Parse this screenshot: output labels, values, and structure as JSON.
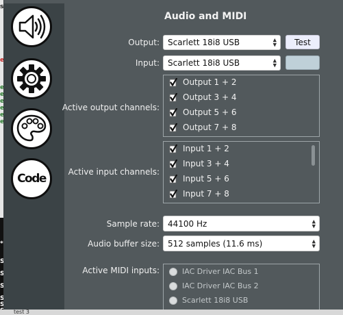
{
  "background_app": {
    "bottom_label": "test 3",
    "edge_chars": [
      "s",
      "e",
      "e",
      "e",
      "e",
      "e",
      "e",
      "e",
      "*",
      "S",
      "S",
      "S",
      "S",
      "S",
      "S"
    ]
  },
  "sidebar": {
    "items": [
      {
        "name": "audio",
        "icon": "speaker-icon"
      },
      {
        "name": "general",
        "icon": "gear-icon"
      },
      {
        "name": "appearance",
        "icon": "palette-icon"
      },
      {
        "name": "code",
        "icon": "code-icon",
        "label": "Code"
      }
    ]
  },
  "panel": {
    "title": "Audio and MIDI",
    "output_label": "Output:",
    "output_value": "Scarlett 18i8 USB",
    "test_button": "Test",
    "input_label": "Input:",
    "input_value": "Scarlett 18i8 USB",
    "active_output_label": "Active output channels:",
    "output_channels": [
      {
        "label": "Output 1 + 2",
        "checked": true
      },
      {
        "label": "Output 3 + 4",
        "checked": true
      },
      {
        "label": "Output 5 + 6",
        "checked": true
      },
      {
        "label": "Output 7 + 8",
        "checked": true
      }
    ],
    "active_input_label": "Active input channels:",
    "input_channels": [
      {
        "label": "Input 1 + 2",
        "checked": true
      },
      {
        "label": "Input 3 + 4",
        "checked": true
      },
      {
        "label": "Input 5 + 6",
        "checked": true
      },
      {
        "label": "Input 7 + 8",
        "checked": true
      }
    ],
    "sample_rate_label": "Sample rate:",
    "sample_rate_value": "44100 Hz",
    "buffer_label": "Audio buffer size:",
    "buffer_value": "512 samples (11.6 ms)",
    "midi_label": "Active MIDI inputs:",
    "midi_inputs": [
      {
        "label": "IAC Driver IAC Bus 1",
        "selected": false
      },
      {
        "label": "IAC Driver IAC Bus 2",
        "selected": false
      },
      {
        "label": "Scarlett 18i8 USB",
        "selected": false
      }
    ]
  },
  "colors": {
    "panel_bg": "#52595c",
    "sidebar_bg": "#3b4346",
    "swatch": "#bfd0d8",
    "test_button_bg": "#eceefc"
  }
}
